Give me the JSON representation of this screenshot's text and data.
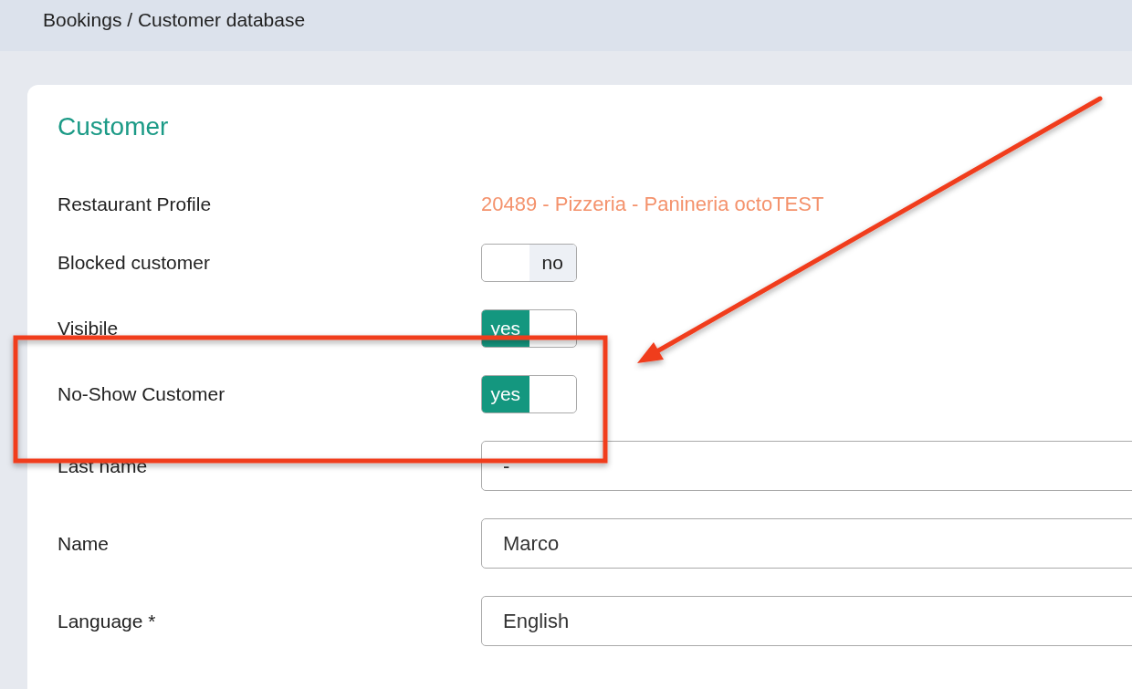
{
  "breadcrumb": "Bookings / Customer database",
  "card": {
    "title": "Customer",
    "rows": [
      {
        "kind": "link",
        "label": "Restaurant Profile",
        "value": "20489 - Pizzeria - Panineria octoTEST"
      },
      {
        "kind": "toggle",
        "label": "Blocked customer",
        "on": false,
        "text": "no"
      },
      {
        "kind": "toggle",
        "label": "Visibile",
        "on": true,
        "text": "yes"
      },
      {
        "kind": "toggle",
        "label": "No-Show Customer",
        "on": true,
        "text": "yes"
      },
      {
        "kind": "input",
        "label": "Last name",
        "value": "-"
      },
      {
        "kind": "input",
        "label": "Name",
        "value": "Marco"
      },
      {
        "kind": "input",
        "label": "Language  *",
        "value": "English"
      }
    ]
  }
}
